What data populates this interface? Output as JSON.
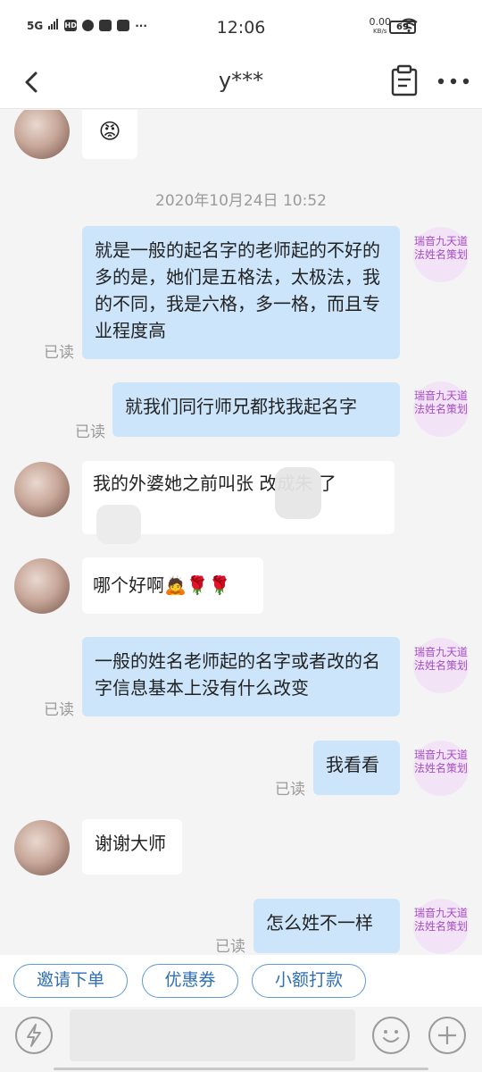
{
  "status_bar": {
    "network": "5G",
    "time": "12:06",
    "speed_value": "0.00",
    "speed_unit": "KB/s",
    "battery": "69"
  },
  "header": {
    "title": "y***"
  },
  "chat": {
    "timestamp": "2020年10月24日 10:52",
    "self_avatar_label": "瑞音九天道法姓名策划",
    "read_label": "已读",
    "messages": [
      {
        "from": "other",
        "text": "😡"
      },
      {
        "from": "self",
        "text": "就是一般的起名字的老师起的不好的多的是，她们是五格法，太极法，我的不同，我是六格，多一格，而且专业程度高"
      },
      {
        "from": "self",
        "text": "就我们同行师兄都找我起名字"
      },
      {
        "from": "other",
        "text": "我的外婆她之前叫张 改成朱 了"
      },
      {
        "from": "other",
        "text": "哪个好啊🙇🌹🌹"
      },
      {
        "from": "self",
        "text": "一般的姓名老师起的名字或者改的名字信息基本上没有什么改变"
      },
      {
        "from": "self",
        "text": "我看看"
      },
      {
        "from": "other",
        "text": "谢谢大师"
      },
      {
        "from": "self",
        "text": "怎么姓不一样"
      }
    ]
  },
  "quick_actions": [
    {
      "label": "邀请下单"
    },
    {
      "label": "优惠券"
    },
    {
      "label": "小额打款"
    }
  ],
  "colors": {
    "outgoing_bubble": "#cde5fb",
    "incoming_bubble": "#ffffff",
    "accent_blue": "#2f6fb6",
    "avatar_purple": "#a64dc4"
  }
}
